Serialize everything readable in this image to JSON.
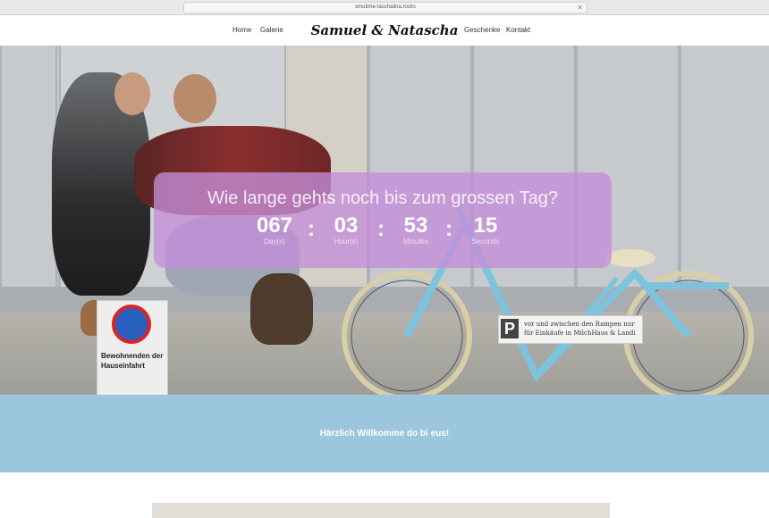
{
  "browser": {
    "url": "smutime-taschalina.rocks"
  },
  "nav": {
    "home": "Home",
    "galerie": "Galerie",
    "logo": "Samuel & Natascha",
    "geschenke": "Geschenke",
    "kontakt": "Kontakt"
  },
  "countdown": {
    "question": "Wie lange gehts noch bis zum grossen Tag?",
    "units": [
      {
        "value": "067",
        "label": "Day(s)"
      },
      {
        "value": "03",
        "label": "Hour(s)"
      },
      {
        "value": "53",
        "label": "Minutes"
      },
      {
        "value": "15",
        "label": "Seconds"
      }
    ]
  },
  "hero": {
    "sign_text": "vor und zwischen den Rampen nur für Einkäufe in MilchHaus & Landi",
    "sign_letter": "P",
    "no_parking_text": "Bewohnenden der Hauseinfahrt"
  },
  "welcome": {
    "text": "Härzlich Willkomme do bi eus!"
  },
  "colors": {
    "accent_purple": "#c48eda",
    "welcome_blue": "#9cc5de",
    "bike_blue": "#7ec3de"
  }
}
